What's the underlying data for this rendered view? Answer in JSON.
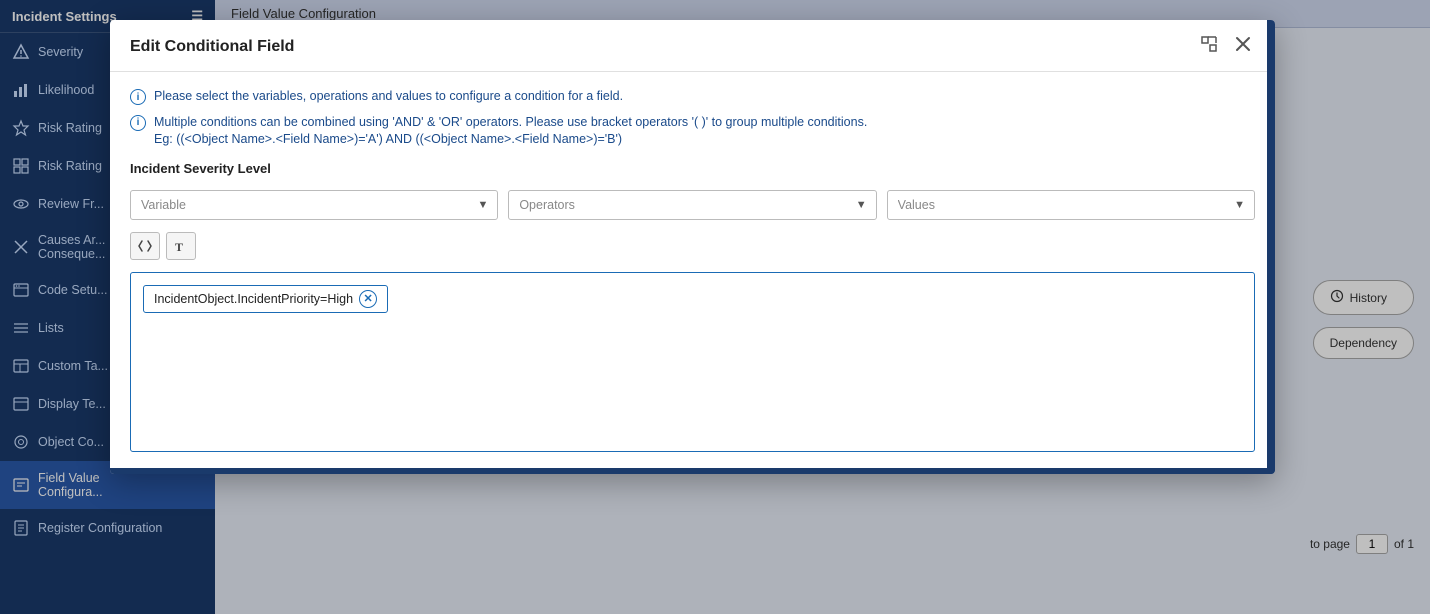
{
  "sidebar": {
    "header": "Incident Settings",
    "items": [
      {
        "id": "severity",
        "label": "Severity",
        "icon": "alert-icon",
        "active": false
      },
      {
        "id": "likelihood",
        "label": "Likelihood",
        "icon": "bar-chart-icon",
        "active": false
      },
      {
        "id": "risk-rating",
        "label": "Risk Rating",
        "icon": "star-icon",
        "active": false
      },
      {
        "id": "risk-rating2",
        "label": "Risk Rating",
        "icon": "grid-icon",
        "active": false
      },
      {
        "id": "review-fr",
        "label": "Review Fr...",
        "icon": "eye-icon",
        "active": false
      },
      {
        "id": "causes-ar",
        "label": "Causes Ar... Conseque...",
        "icon": "x-icon",
        "active": false
      },
      {
        "id": "code-setu",
        "label": "Code Setu...",
        "icon": "settings-icon",
        "active": false
      },
      {
        "id": "lists",
        "label": "Lists",
        "icon": "list-icon",
        "active": false
      },
      {
        "id": "custom-ta",
        "label": "Custom Ta...",
        "icon": "table-icon",
        "active": false
      },
      {
        "id": "display-te",
        "label": "Display Te...",
        "icon": "table-icon",
        "active": false
      },
      {
        "id": "object-co",
        "label": "Object Co...",
        "icon": "settings-icon",
        "active": false
      },
      {
        "id": "field-value",
        "label": "Field Value Configuration",
        "icon": "field-icon",
        "active": true
      },
      {
        "id": "register-config",
        "label": "Register Configuration",
        "icon": "register-icon",
        "active": false
      }
    ]
  },
  "page_header": "Field Value Configuration",
  "right_buttons": {
    "history": "History",
    "dependency": "Dependency"
  },
  "pagination": {
    "prefix": "to page",
    "current": "1",
    "total": "of 1"
  },
  "modal": {
    "title": "Edit Conditional Field",
    "info1": "Please select the variables, operations and values to configure a condition for a field.",
    "info2": "Multiple conditions can be combined using 'AND' & 'OR' operators. Please use bracket operators '( )' to group multiple conditions.",
    "info2_example": "Eg: ((<Object Name>.<Field Name>)='A') AND ((<Object Name>.<Field Name>)='B')",
    "field_label": "Incident Severity Level",
    "variable_placeholder": "Variable",
    "operators_placeholder": "Operators",
    "values_placeholder": "Values",
    "condition_value": "IncidentObject.IncidentPriority=High",
    "remove_label": "X"
  }
}
